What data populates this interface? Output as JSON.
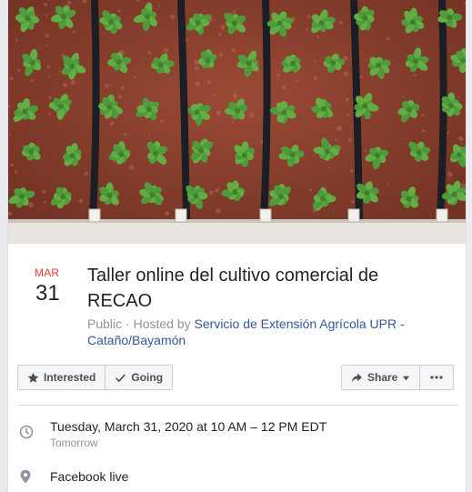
{
  "event": {
    "month": "MAR",
    "day": "31",
    "title": "Taller online del cultivo comercial de RECAO",
    "privacy": "Public",
    "hosted_by_prefix": "Hosted by",
    "host": "Servicio de Extensión Agrícola UPR - Cataño/Bayamón"
  },
  "actions": {
    "interested_label": "Interested",
    "going_label": "Going",
    "share_label": "Share",
    "more_icon": "more-dots-icon"
  },
  "details": {
    "datetime": "Tuesday, March 31, 2020 at 10 AM – 12 PM EDT",
    "relative": "Tomorrow",
    "location": "Facebook live"
  },
  "icons": {
    "star": "star-icon",
    "check": "check-icon",
    "share": "share-arrow-icon",
    "caret": "caret-down-icon",
    "clock": "clock-icon",
    "pin": "location-pin-icon"
  },
  "colors": {
    "month_red": "#e53935",
    "link_blue": "#365899",
    "secondary_text": "#90949c"
  }
}
